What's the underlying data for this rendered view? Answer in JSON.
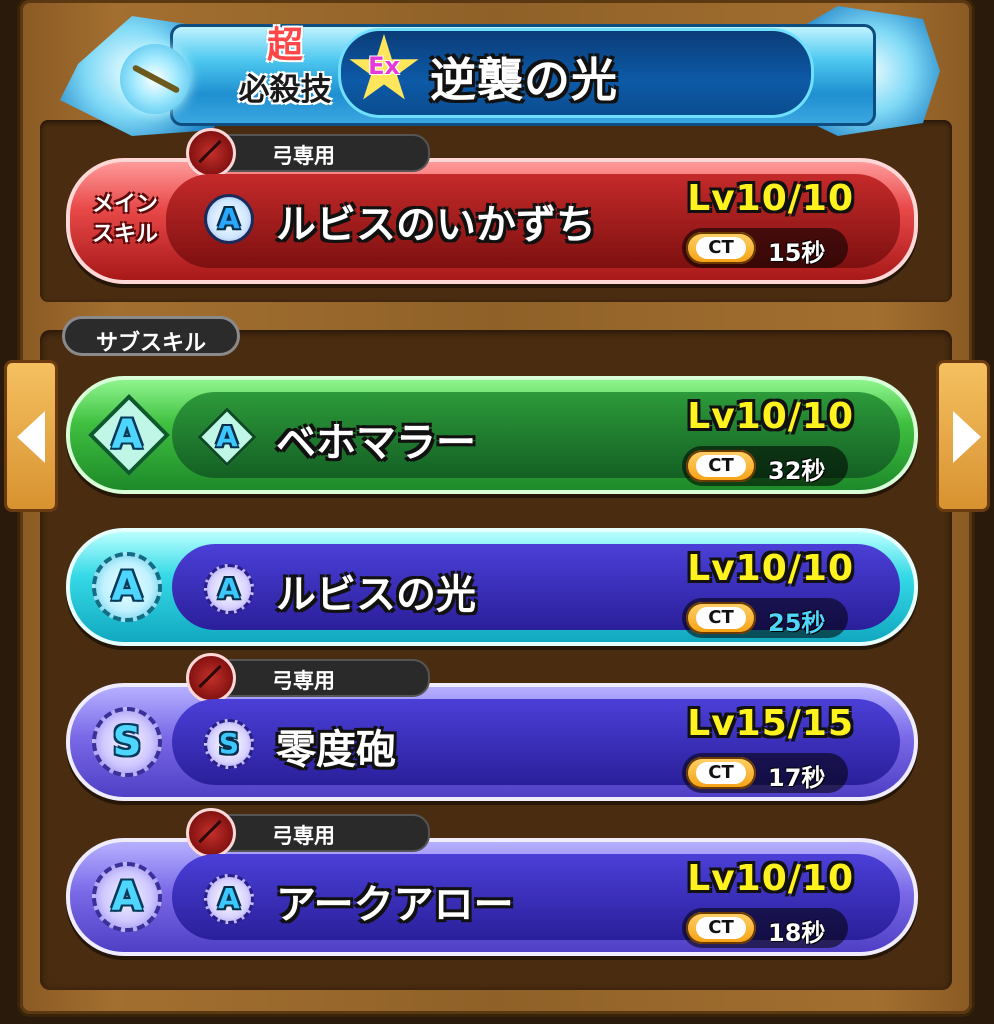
{
  "header": {
    "cho": "超",
    "hissatsu": "必殺技",
    "ex": "Ex",
    "title": "逆襲の光"
  },
  "main_skill": {
    "label_line1": "メイン",
    "label_line2": "スキル",
    "tag": "弓専用",
    "type": "A",
    "name": "ルビスのいかずち",
    "level": "Lv10/10",
    "ct_label": "CT",
    "ct": "15秒"
  },
  "sub_label": "サブスキル",
  "sub_skills": [
    {
      "type": "A",
      "name": "ベホマラー",
      "level": "Lv10/10",
      "ct_label": "CT",
      "ct": "32秒",
      "color": "#3fbf3f"
    },
    {
      "type": "A",
      "name": "ルビスの光",
      "level": "Lv10/10",
      "ct_label": "CT",
      "ct": "25秒",
      "color": "#35d9e6"
    },
    {
      "tag": "弓専用",
      "type": "S",
      "name": "零度砲",
      "level": "Lv15/15",
      "ct_label": "CT",
      "ct": "17秒",
      "color": "#7a6ae8"
    },
    {
      "tag": "弓専用",
      "type": "A",
      "name": "アークアロー",
      "level": "Lv10/10",
      "ct_label": "CT",
      "ct": "18秒",
      "color": "#7a6ae8"
    }
  ],
  "icons": {
    "prev": "chevron-left-icon",
    "next": "chevron-right-icon",
    "bow": "bow-icon",
    "weapon": "weapon-icon"
  }
}
